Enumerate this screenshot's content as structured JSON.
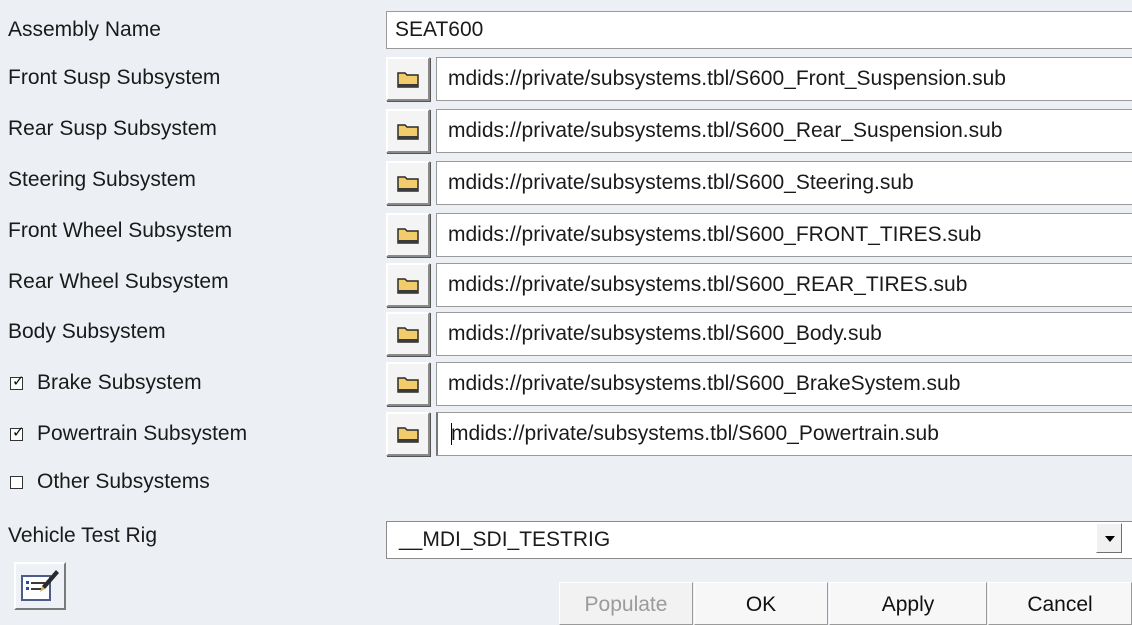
{
  "assembly": {
    "label": "Assembly Name",
    "value": "SEAT600"
  },
  "subsystems": [
    {
      "label": "Front Susp Subsystem",
      "path": "mdids://private/subsystems.tbl/S600_Front_Suspension.sub"
    },
    {
      "label": "Rear Susp Subsystem",
      "path": "mdids://private/subsystems.tbl/S600_Rear_Suspension.sub"
    },
    {
      "label": "Steering Subsystem",
      "path": "mdids://private/subsystems.tbl/S600_Steering.sub"
    },
    {
      "label": "Front Wheel Subsystem",
      "path": "mdids://private/subsystems.tbl/S600_FRONT_TIRES.sub"
    },
    {
      "label": "Rear Wheel Subsystem",
      "path": "mdids://private/subsystems.tbl/S600_REAR_TIRES.sub"
    },
    {
      "label": "Body Subsystem",
      "path": "mdids://private/subsystems.tbl/S600_Body.sub"
    },
    {
      "label": "Brake Subsystem",
      "path": "mdids://private/subsystems.tbl/S600_BrakeSystem.sub",
      "checked": true
    },
    {
      "label": "Powertrain Subsystem",
      "path": "mdids://private/subsystems.tbl/S600_Powertrain.sub",
      "checked": true
    }
  ],
  "other": {
    "label": "Other Subsystems",
    "checked": false
  },
  "test_rig": {
    "label": "Vehicle Test Rig",
    "value": "__MDI_SDI_TESTRIG"
  },
  "buttons": {
    "populate": "Populate",
    "ok": "OK",
    "apply": "Apply",
    "cancel": "Cancel"
  },
  "icons": {
    "folder": "folder-icon",
    "tool": "notes-edit-icon",
    "dropdown": "chevron-down-icon"
  },
  "colors": {
    "background": "#ecf0f4",
    "folder_fill": "#f2cc6b",
    "folder_outline": "#2b2b2b"
  }
}
